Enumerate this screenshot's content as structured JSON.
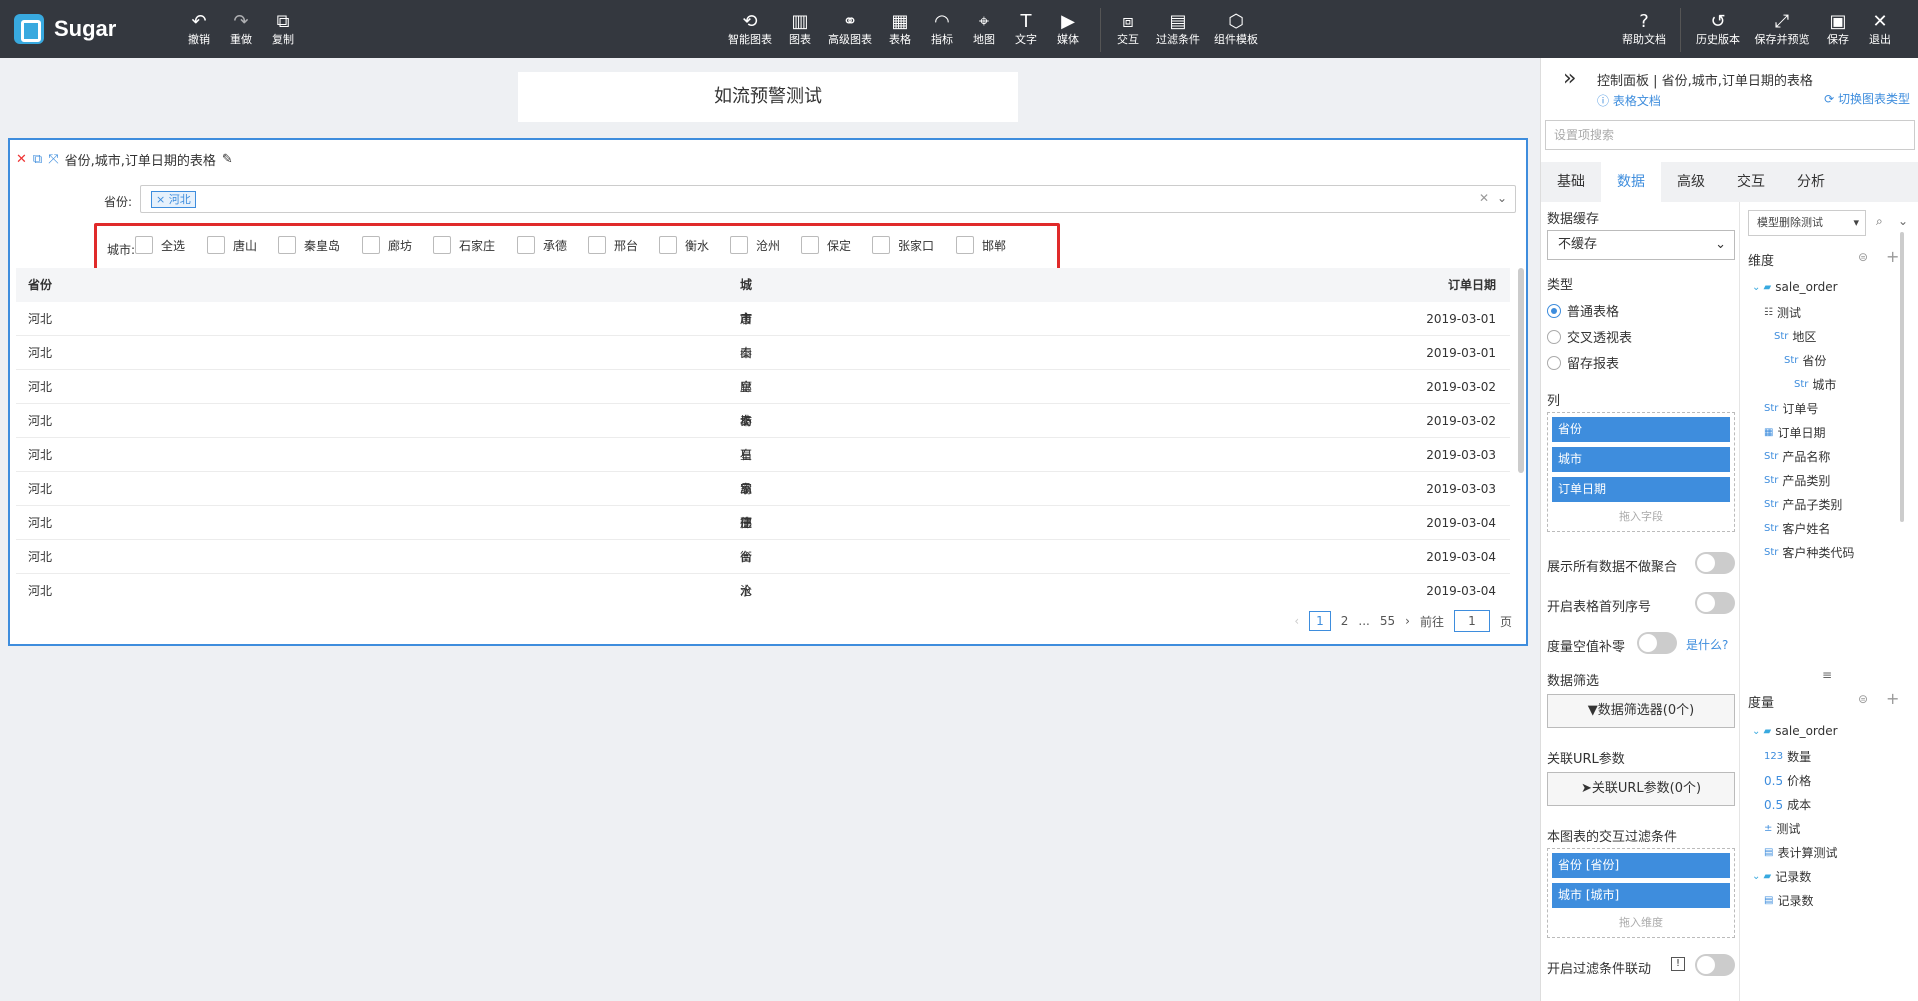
{
  "app": {
    "name": "Sugar"
  },
  "toolbar": {
    "left": [
      {
        "icon": "undo-icon",
        "label": "撤销"
      },
      {
        "icon": "redo-icon",
        "label": "重做"
      },
      {
        "icon": "copy-icon",
        "label": "复制"
      }
    ],
    "center": [
      {
        "icon": "smart-chart-icon",
        "label": "智能图表"
      },
      {
        "icon": "chart-icon",
        "label": "图表"
      },
      {
        "icon": "advanced-chart-icon",
        "label": "高级图表"
      },
      {
        "icon": "table-icon",
        "label": "表格"
      },
      {
        "icon": "gauge-icon",
        "label": "指标"
      },
      {
        "icon": "map-icon",
        "label": "地图"
      },
      {
        "icon": "text-icon",
        "label": "文字"
      },
      {
        "icon": "media-icon",
        "label": "媒体"
      },
      {
        "icon": "interaction-icon",
        "label": "交互"
      },
      {
        "icon": "filter-icon",
        "label": "过滤条件"
      },
      {
        "icon": "template-icon",
        "label": "组件模板"
      }
    ],
    "right": [
      {
        "icon": "help-icon",
        "label": "帮助文档"
      },
      {
        "icon": "history-icon",
        "label": "历史版本"
      },
      {
        "icon": "save-preview-icon",
        "label": "保存并预览"
      },
      {
        "icon": "save-icon",
        "label": "保存"
      },
      {
        "icon": "exit-icon",
        "label": "退出"
      }
    ]
  },
  "dashboard": {
    "title": "如流预警测试"
  },
  "chart_widget": {
    "title": "省份,城市,订单日期的表格",
    "province_filter": {
      "label": "省份:",
      "selected": "河北"
    },
    "city_filter": {
      "label": "城市:",
      "options": [
        "全选",
        "唐山",
        "秦皇岛",
        "廊坊",
        "石家庄",
        "承德",
        "邢台",
        "衡水",
        "沧州",
        "保定",
        "张家口",
        "邯郸"
      ]
    },
    "table": {
      "headers": [
        "省份",
        "城市",
        "订单日期"
      ],
      "rows": [
        [
          "河北",
          "唐山",
          "2019-03-01"
        ],
        [
          "河北",
          "秦皇岛",
          "2019-03-01"
        ],
        [
          "河北",
          "廊坊",
          "2019-03-02"
        ],
        [
          "河北",
          "秦皇岛",
          "2019-03-02"
        ],
        [
          "河北",
          "石家庄",
          "2019-03-03"
        ],
        [
          "河北",
          "承德",
          "2019-03-03"
        ],
        [
          "河北",
          "邢台",
          "2019-03-04"
        ],
        [
          "河北",
          "衡水",
          "2019-03-04"
        ],
        [
          "河北",
          "沧州",
          "2019-03-04"
        ]
      ]
    },
    "pagination": {
      "current": "1",
      "next": "2",
      "ellipsis": "...",
      "last": "55",
      "goto_label": "前往",
      "goto_value": "1",
      "page_suffix": "页"
    }
  },
  "panel": {
    "title": "控制面板 | 省份,城市,订单日期的表格",
    "doc_link": "表格文档",
    "switch_link": "切换图表类型",
    "search_placeholder": "设置项搜索",
    "tabs": [
      "基础",
      "数据",
      "高级",
      "交互",
      "分析"
    ],
    "active_tab": "数据",
    "cache_label": "数据缓存",
    "cache_value": "不缓存",
    "type_label": "类型",
    "types": [
      "普通表格",
      "交叉透视表",
      "留存报表"
    ],
    "columns_label": "列",
    "columns": [
      "省份",
      "城市",
      "订单日期"
    ],
    "drop_field_hint": "拖入字段",
    "toggle_all_data": "展示所有数据不做聚合",
    "toggle_row_number": "开启表格首列序号",
    "toggle_zero_fill": "度量空值补零",
    "what_is": "是什么?",
    "data_filter_label": "数据筛选",
    "data_filter_button": "数据筛选器(0个)",
    "url_param_label": "关联URL参数",
    "url_param_button": "关联URL参数(0个)",
    "interaction_filter_label": "本图表的交互过滤条件",
    "interaction_fields": [
      "省份 [省份]",
      "城市 [城市]"
    ],
    "drop_dim_hint": "拖入维度",
    "toggle_filter_link": "开启过滤条件联动"
  },
  "model_tree": {
    "model_select": "模型删除测试",
    "dimension_label": "维度",
    "dimensions": [
      {
        "text": "sale_order",
        "type": "folder",
        "indent": 0
      },
      {
        "text": "测试",
        "type": "hier",
        "indent": 1
      },
      {
        "text": "地区",
        "type": "Str",
        "indent": 2
      },
      {
        "text": "省份",
        "type": "Str",
        "indent": 3
      },
      {
        "text": "城市",
        "type": "Str",
        "indent": 4
      },
      {
        "text": "订单号",
        "type": "Str",
        "indent": 1
      },
      {
        "text": "订单日期",
        "type": "date",
        "indent": 1
      },
      {
        "text": "产品名称",
        "type": "Str",
        "indent": 1
      },
      {
        "text": "产品类别",
        "type": "Str",
        "indent": 1
      },
      {
        "text": "产品子类别",
        "type": "Str",
        "indent": 1
      },
      {
        "text": "客户姓名",
        "type": "Str",
        "indent": 1
      },
      {
        "text": "客户种类代码",
        "type": "Str",
        "indent": 1
      }
    ],
    "measure_label": "度量",
    "measures": [
      {
        "text": "sale_order",
        "type": "folder",
        "indent": 0
      },
      {
        "text": "数量",
        "type": "123",
        "indent": 1
      },
      {
        "text": "价格",
        "type": "0.5",
        "indent": 1
      },
      {
        "text": "成本",
        "type": "0.5",
        "indent": 1
      },
      {
        "text": "测试",
        "type": "calc",
        "indent": 1
      },
      {
        "text": "表计算测试",
        "type": "calc2",
        "indent": 1
      },
      {
        "text": "记录数",
        "type": "folder",
        "indent": 0
      },
      {
        "text": "记录数",
        "type": "calc2",
        "indent": 1
      }
    ]
  }
}
